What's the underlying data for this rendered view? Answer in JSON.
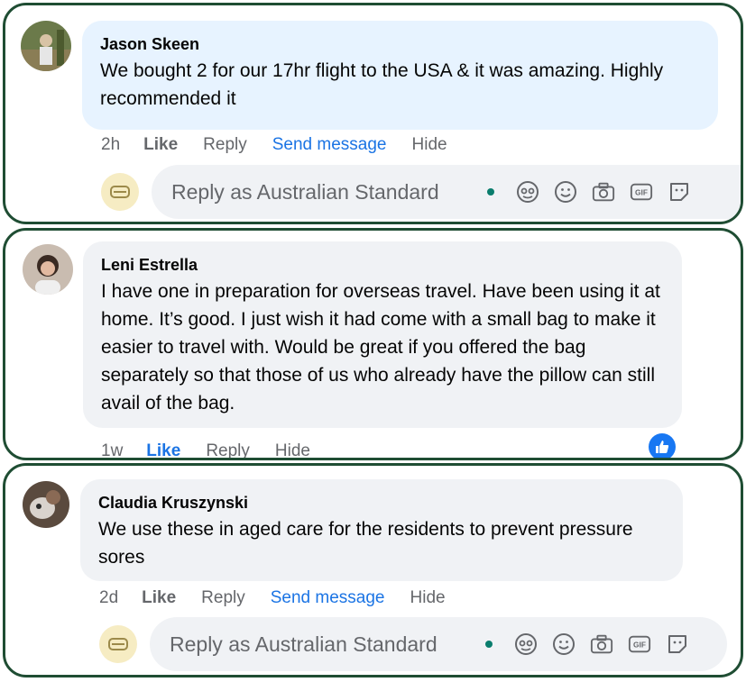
{
  "comments": [
    {
      "author": "Jason Skeen",
      "text": "We bought 2 for our 17hr flight to the USA & it was amazing. Highly recommended it",
      "time": "2h",
      "like": "Like",
      "reply": "Reply",
      "send_message": "Send message",
      "hide": "Hide",
      "reply_placeholder": "Reply as Australian Standard"
    },
    {
      "author": "Leni Estrella",
      "text": "I have one in preparation for overseas travel. Have been using it at home. It’s good. I just wish it had come with a small bag to make it easier to travel with. Would be great if you offered the bag separately so that those of us who already have the pillow can still avail of the bag.",
      "time": "1w",
      "like": "Like",
      "reply": "Reply",
      "hide": "Hide"
    },
    {
      "author": "Claudia Kruszynski",
      "text": "We use these in aged care for the residents to prevent pressure sores",
      "time": "2d",
      "like": "Like",
      "reply": "Reply",
      "send_message": "Send message",
      "hide": "Hide",
      "reply_placeholder": "Reply as Australian Standard"
    }
  ],
  "colors": {
    "border": "#1f4d33",
    "link_blue": "#1b74e4",
    "bubble": "#f0f2f5",
    "bubble_highlight": "#e7f3ff",
    "online_dot": "#0a7d6d"
  },
  "icons": [
    "avatar-sticker-icon",
    "emoji-icon",
    "camera-icon",
    "gif-icon",
    "sticker-icon",
    "like-reaction-icon"
  ]
}
